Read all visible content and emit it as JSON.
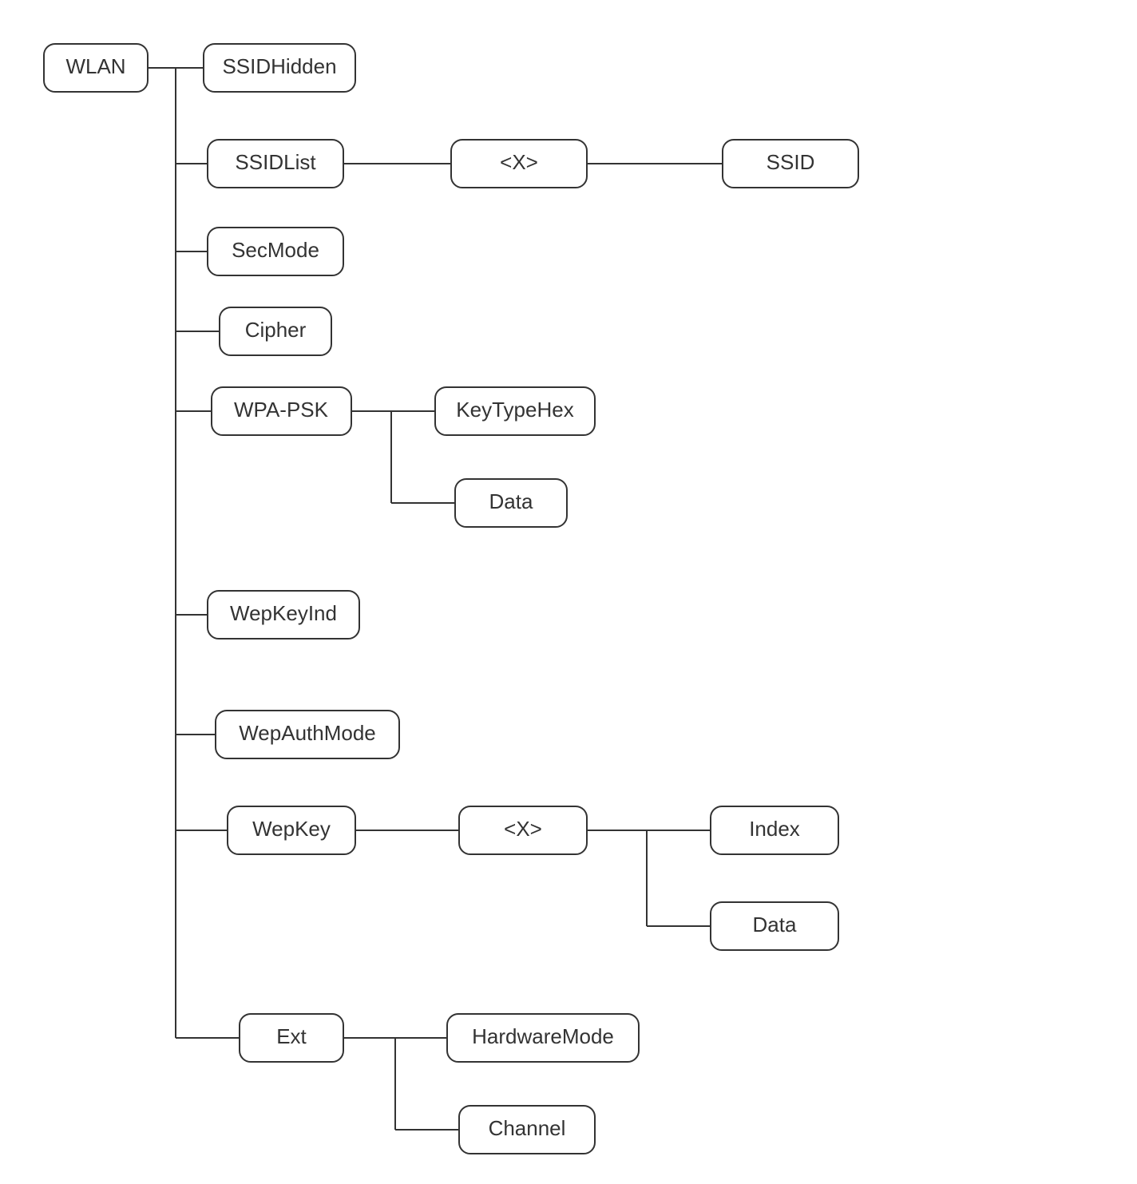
{
  "diagram": {
    "root": "WLAN",
    "nodes": {
      "wlan": "WLAN",
      "ssidhidden": "SSIDHidden",
      "ssidlist": "SSIDList",
      "ssidlist_x": "<X>",
      "ssid": "SSID",
      "secmode": "SecMode",
      "cipher": "Cipher",
      "wpapsk": "WPA-PSK",
      "keytypehex": "KeyTypeHex",
      "wpapsk_data": "Data",
      "wepkeyind": "WepKeyInd",
      "wepauthmode": "WepAuthMode",
      "wepkey": "WepKey",
      "wepkey_x": "<X>",
      "index": "Index",
      "wepkey_data": "Data",
      "ext": "Ext",
      "hardwaremode": "HardwareMode",
      "channel": "Channel"
    }
  }
}
